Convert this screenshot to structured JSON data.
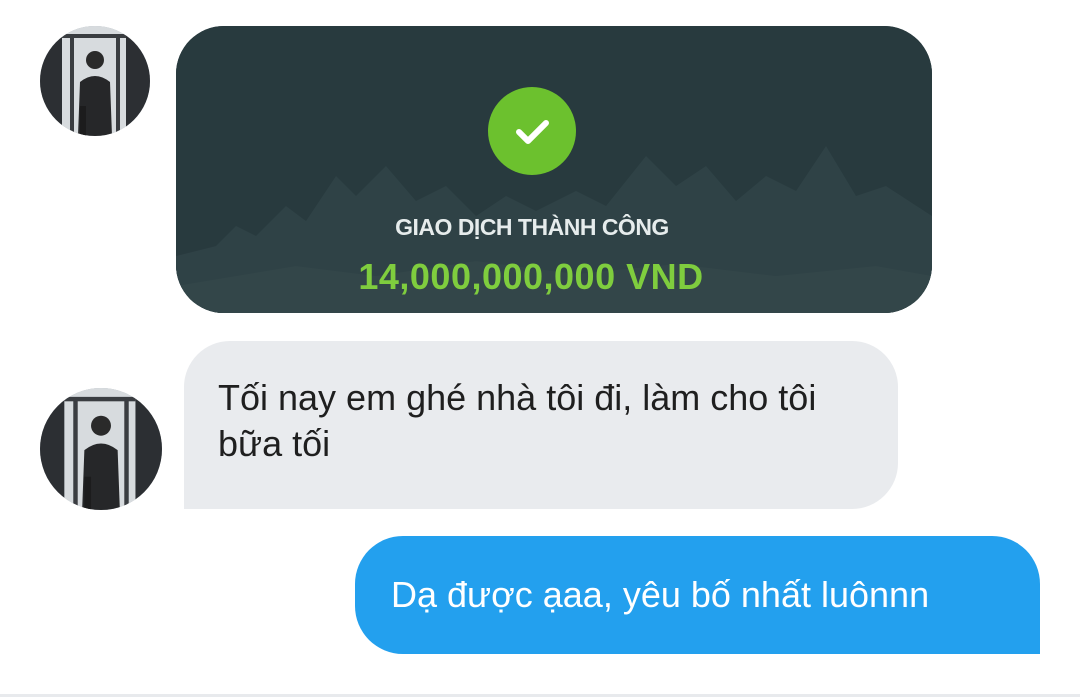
{
  "conversation": {
    "messages": [
      {
        "sender": "other",
        "type": "image",
        "image": {
          "icon": "check-icon",
          "title": "GIAO DỊCH THÀNH CÔNG",
          "amount": "14,000,000,000 VND"
        }
      },
      {
        "sender": "other",
        "type": "text",
        "text": "Tối nay em ghé nhà tôi đi, làm cho tôi bữa tối"
      },
      {
        "sender": "me",
        "type": "text",
        "text": "Dạ được ạaa, yêu bố nhất luônnn"
      }
    ]
  },
  "colors": {
    "received_bubble": "#e9ebee",
    "sent_bubble": "#23a0ee",
    "success_green": "#6cc12e",
    "image_bg": "#283a3e"
  }
}
